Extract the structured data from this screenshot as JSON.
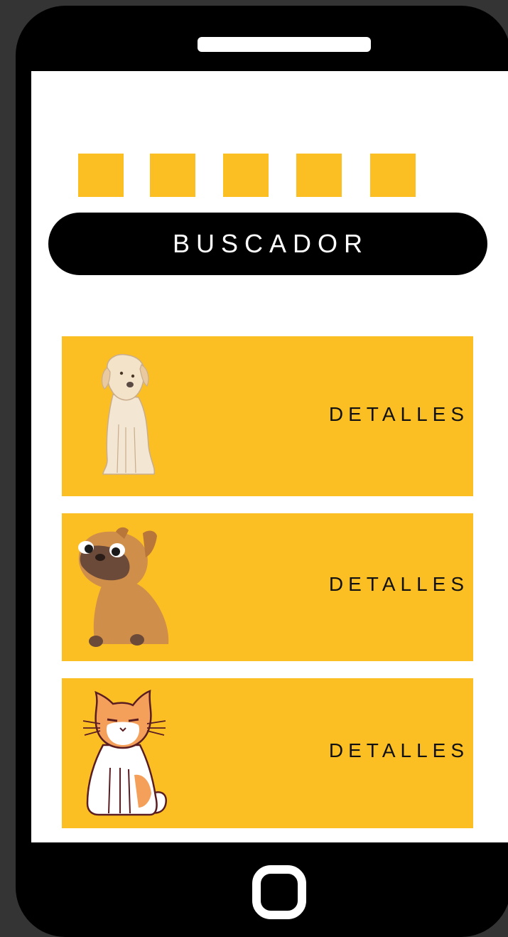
{
  "search": {
    "label": "BUSCADOR"
  },
  "cards": [
    {
      "pet": "labrador-dog",
      "details_label": "DETALLES"
    },
    {
      "pet": "pug-dog",
      "details_label": "DETALLES"
    },
    {
      "pet": "orange-white-cat",
      "details_label": "DETALLES"
    }
  ],
  "colors": {
    "accent": "#fbbf24",
    "background": "#353434",
    "phone": "#000000"
  }
}
